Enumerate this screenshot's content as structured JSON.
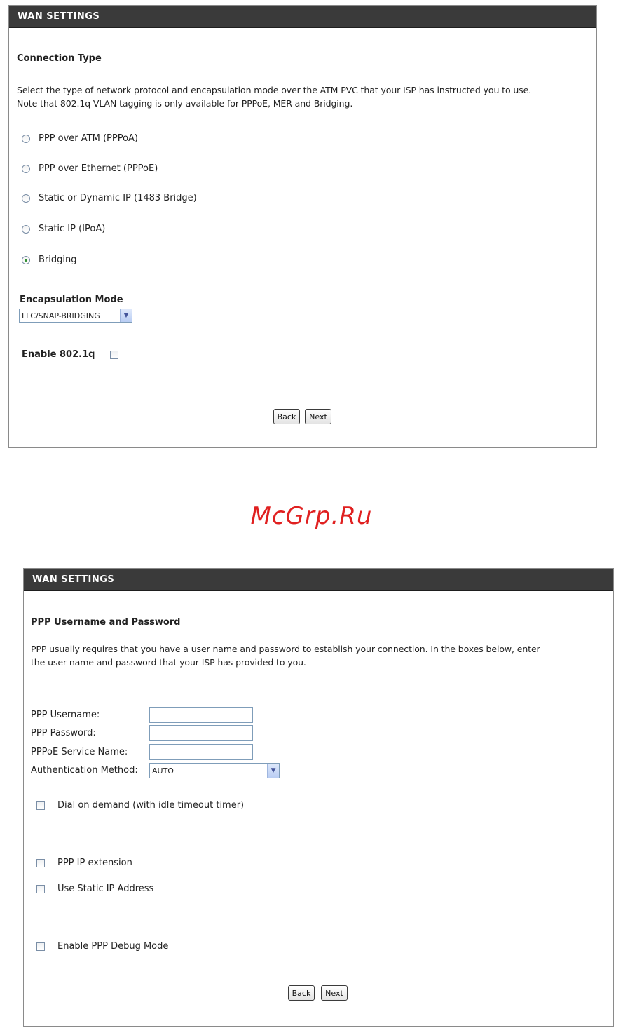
{
  "panel1": {
    "header": "WAN SETTINGS",
    "section_title": "Connection Type",
    "description_lines": [
      "Select the type of network protocol and encapsulation mode over the ATM PVC that your ISP has instructed you to use.",
      "Note that 802.1q VLAN tagging is only available for PPPoE, MER and Bridging."
    ],
    "options": [
      {
        "label": "PPP over ATM (PPPoA)",
        "checked": false
      },
      {
        "label": "PPP over Ethernet (PPPoE)",
        "checked": false
      },
      {
        "label": "Static or Dynamic IP (1483 Bridge)",
        "checked": false
      },
      {
        "label": "Static IP (IPoA)",
        "checked": false
      },
      {
        "label": "Bridging",
        "checked": true
      }
    ],
    "encap_label": "Encapsulation Mode",
    "encap_value": "LLC/SNAP-BRIDGING",
    "vlan_label": "Enable 802.1q",
    "back_label": "Back",
    "next_label": "Next"
  },
  "watermark": "McGrp.Ru",
  "panel2": {
    "header": "WAN SETTINGS",
    "section_title": "PPP Username and Password",
    "description_lines": [
      "PPP usually requires that you have a user name and password to establish your connection. In the boxes below, enter",
      "the user name and password that your ISP has provided to you."
    ],
    "username_label": "PPP Username:",
    "username_value": "",
    "password_label": "PPP Password:",
    "password_value": "",
    "service_label": "PPPoE Service Name:",
    "service_value": "",
    "auth_label": "Authentication Method:",
    "auth_value": "AUTO",
    "dial_label": "Dial on demand (with idle timeout timer)",
    "ipext_label": "PPP IP extension",
    "static_label": "Use Static IP Address",
    "debug_label": "Enable PPP Debug Mode",
    "back_label": "Back",
    "next_label": "Next"
  }
}
